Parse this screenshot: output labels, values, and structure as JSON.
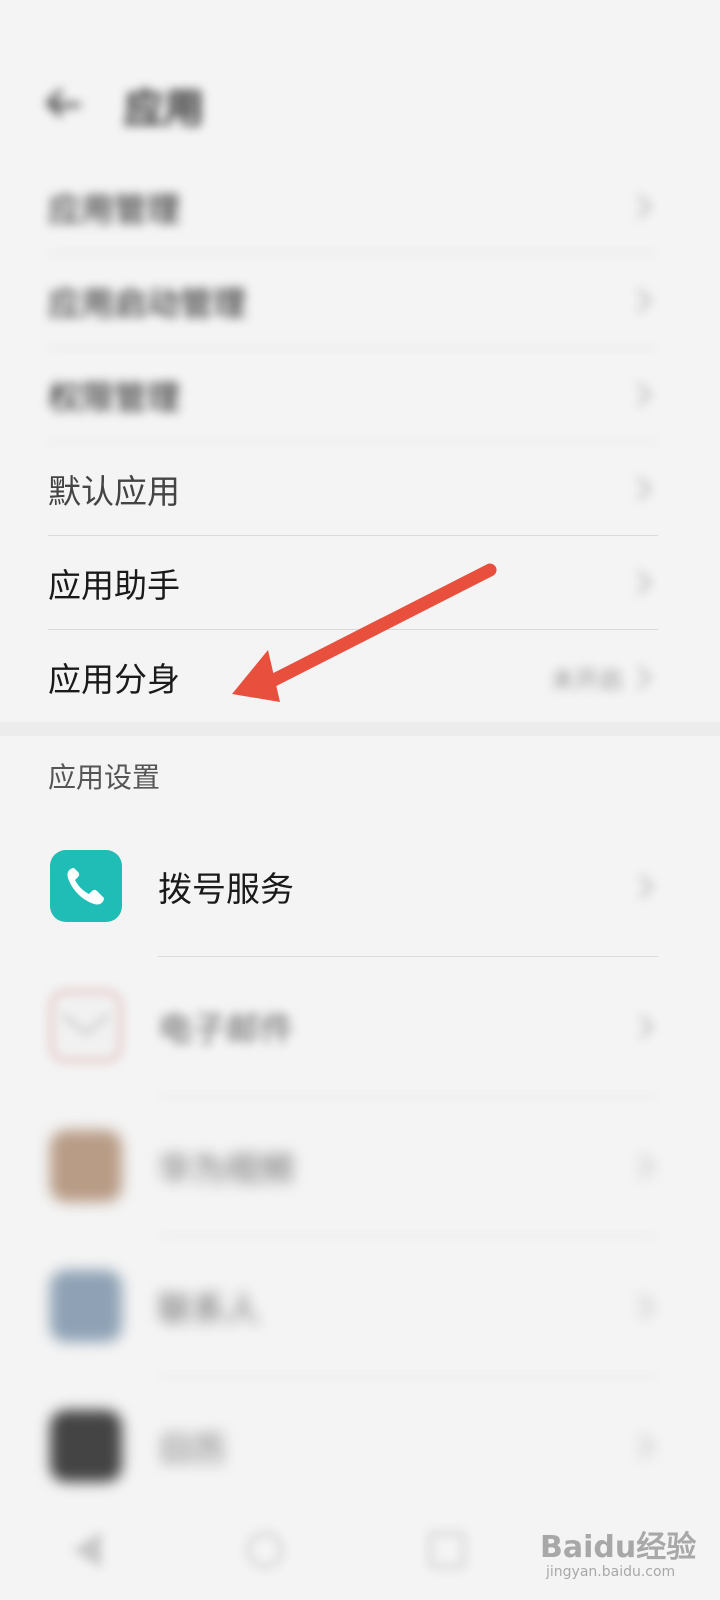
{
  "status_bar": {
    "time": "",
    "indicators": ""
  },
  "header": {
    "title": "应用"
  },
  "settings_list": [
    {
      "label": "应用管理",
      "value": "",
      "blurred": true
    },
    {
      "label": "应用启动管理",
      "value": "",
      "blurred": true
    },
    {
      "label": "权限管理",
      "value": "",
      "blurred": true
    },
    {
      "label": "默认应用",
      "value": "",
      "blurred": false
    },
    {
      "label": "应用助手",
      "value": "",
      "blurred": false
    },
    {
      "label": "应用分身",
      "value": "未开启",
      "blurred": false
    }
  ],
  "app_settings": {
    "title": "应用设置",
    "items": [
      {
        "name": "拨号服务",
        "icon": "phone-icon",
        "color": "#1fbdb6"
      },
      {
        "name": "电子邮件",
        "icon": "mail-icon",
        "color": "#f1f1f1"
      },
      {
        "name": "华为视频",
        "icon": "video-icon",
        "color": "#b89c86"
      },
      {
        "name": "联系人",
        "icon": "contacts-icon",
        "color": "#8fa2b5"
      },
      {
        "name": "日历",
        "icon": "calendar-icon",
        "color": "#444444"
      }
    ]
  },
  "watermark": {
    "brand": "Baidu经验",
    "url": "jingyan.baidu.com"
  },
  "colors": {
    "annotation_arrow": "#e94f3d",
    "accent_teal": "#1fbdb6"
  }
}
